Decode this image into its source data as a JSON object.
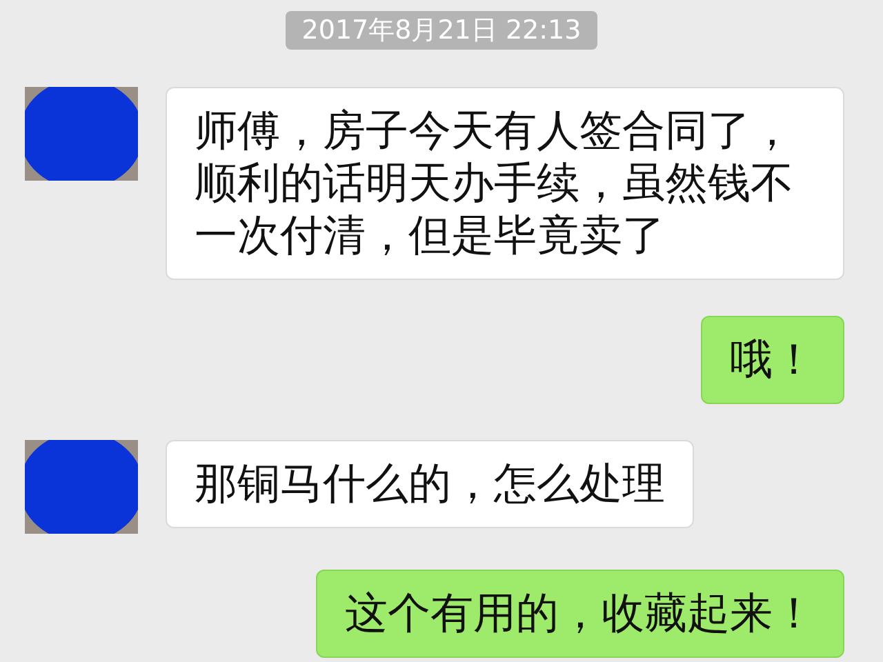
{
  "timestamp": "2017年8月21日 22:13",
  "messages": [
    {
      "kind": "incoming",
      "text": "师傅，房子今天有人签合同了，顺利的话明天办手续，虽然钱不一次付清，但是毕竟卖了"
    },
    {
      "kind": "outgoing",
      "text": "哦！"
    },
    {
      "kind": "incoming",
      "text": "那铜马什么的，怎么处理"
    },
    {
      "kind": "outgoing",
      "text": "这个有用的，收藏起来！"
    }
  ]
}
